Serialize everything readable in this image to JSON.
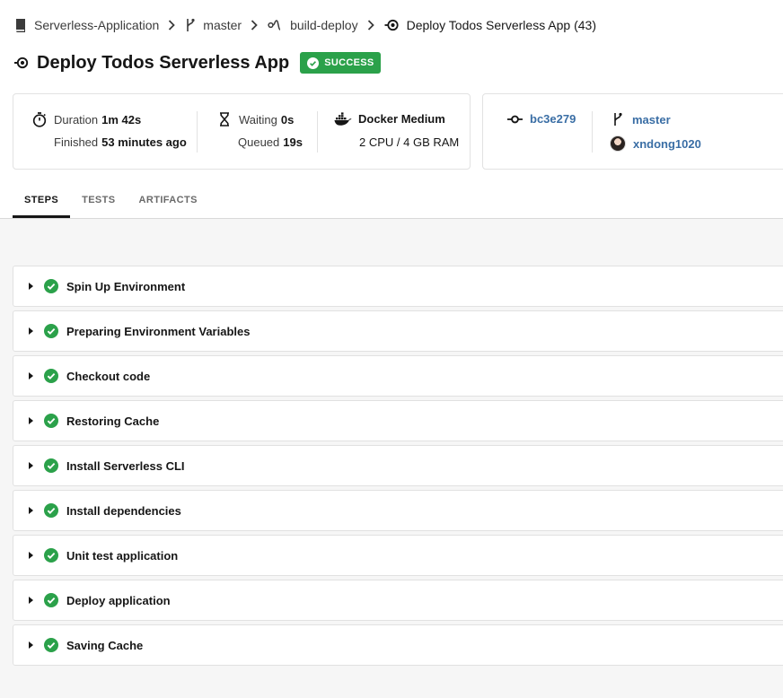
{
  "breadcrumb": {
    "project": "Serverless-Application",
    "branch": "master",
    "workflow": "build-deploy",
    "job": "Deploy Todos Serverless App (43)"
  },
  "header": {
    "title": "Deploy Todos Serverless App",
    "status": "SUCCESS",
    "status_color": "#2ba14a"
  },
  "metrics": {
    "duration_label": "Duration",
    "duration_value": "1m 42s",
    "finished_label": "Finished",
    "finished_value": "53 minutes ago",
    "waiting_label": "Waiting",
    "waiting_value": "0s",
    "queued_label": "Queued",
    "queued_value": "19s",
    "executor_name": "Docker Medium",
    "executor_spec": "2 CPU / 4 GB RAM"
  },
  "commit": {
    "sha": "bc3e279",
    "branch": "master",
    "author": "xndong1020"
  },
  "tabs": [
    {
      "label": "STEPS",
      "active": true
    },
    {
      "label": "TESTS",
      "active": false
    },
    {
      "label": "ARTIFACTS",
      "active": false
    }
  ],
  "steps": [
    {
      "label": "Spin Up Environment",
      "status": "success"
    },
    {
      "label": "Preparing Environment Variables",
      "status": "success"
    },
    {
      "label": "Checkout code",
      "status": "success"
    },
    {
      "label": "Restoring Cache",
      "status": "success"
    },
    {
      "label": "Install Serverless CLI",
      "status": "success"
    },
    {
      "label": "Install dependencies",
      "status": "success"
    },
    {
      "label": "Unit test application",
      "status": "success"
    },
    {
      "label": "Deploy application",
      "status": "success"
    },
    {
      "label": "Saving Cache",
      "status": "success"
    }
  ],
  "icons": {
    "project": "book-icon",
    "branch": "git-branch-icon",
    "workflow": "workflow-icon",
    "job": "job-icon",
    "duration": "stopwatch-icon",
    "waiting": "hourglass-icon",
    "executor": "docker-icon",
    "commit": "git-commit-icon",
    "step_status": "check-circle-icon",
    "step_toggle": "caret-right-icon"
  },
  "colors": {
    "success": "#2ba14a",
    "link": "#3a6ea5"
  }
}
